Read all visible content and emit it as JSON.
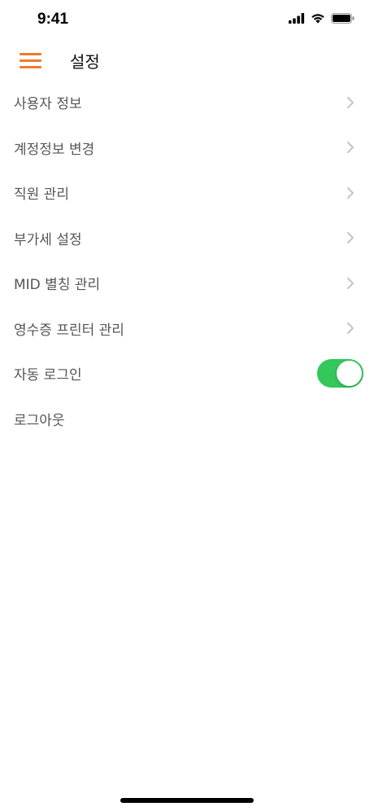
{
  "status_bar": {
    "time": "9:41",
    "icons": [
      "cellular-signal-icon",
      "wifi-icon",
      "battery-icon"
    ]
  },
  "header": {
    "menu_icon": "hamburger-menu-icon",
    "title": "설정"
  },
  "settings": {
    "items": [
      {
        "label": "사용자 정보",
        "type": "link"
      },
      {
        "label": "계정정보 변경",
        "type": "link"
      },
      {
        "label": "직원 관리",
        "type": "link"
      },
      {
        "label": "부가세 설정",
        "type": "link"
      },
      {
        "label": "MID 별칭 관리",
        "type": "link"
      },
      {
        "label": "영수증 프린터 관리",
        "type": "link"
      },
      {
        "label": "자동 로그인",
        "type": "toggle",
        "on": true
      },
      {
        "label": "로그아웃",
        "type": "action"
      }
    ]
  },
  "colors": {
    "accent": "#f07a2e",
    "toggle_on": "#34c759",
    "label_text": "#555555",
    "chevron": "#c4c4c7"
  }
}
